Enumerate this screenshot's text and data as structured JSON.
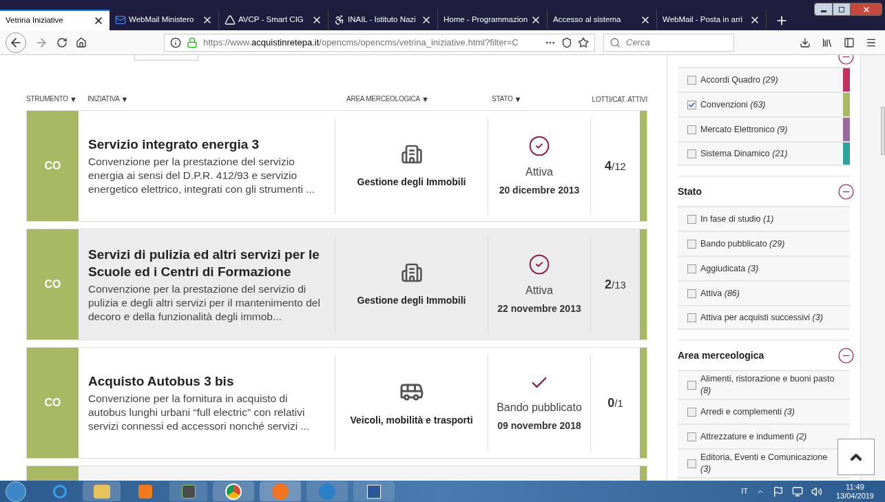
{
  "browser": {
    "tabs": [
      {
        "title": "Vetrina Iniziative",
        "selected": true
      },
      {
        "title": "WebMail Ministero",
        "selected": false
      },
      {
        "title": "AVCP - Smart CIG",
        "selected": false
      },
      {
        "title": "INAIL - Istituto Nazi",
        "selected": false
      },
      {
        "title": "Home - Programmazion",
        "selected": false
      },
      {
        "title": "Accesso al sistema",
        "selected": false
      },
      {
        "title": "WebMail - Posta in arri",
        "selected": false
      }
    ],
    "url_prefix": "https://www.",
    "url_domain": "acquistinretepa.it",
    "url_path": "/opencms/opencms/vetrina_iniziative.html?filter=C",
    "search_placeholder": "Cerca"
  },
  "table": {
    "columns": [
      {
        "label": "STRUMENTO",
        "sort_arrow": "▼"
      },
      {
        "label": "INIZIATIVA",
        "sort_arrow": "▼"
      },
      {
        "label": "AREA MERCEOLOGICA",
        "sort_arrow": "▼"
      },
      {
        "label": "STATO",
        "sort_arrow": "▼"
      },
      {
        "label": "LOTTI/CAT. ATTIVI"
      }
    ],
    "rows": [
      {
        "tool": "CO",
        "title": "Servizio integrato energia 3",
        "description": "Convenzione per la prestazione del servizio energia ai sensi del D.P.R. 412/93 e servizio energetico elettrico, integrati con gli strumenti ...",
        "area": {
          "kind": "building",
          "label": "Gestione degli Immobili"
        },
        "status": {
          "kind": "active",
          "label": "Attiva",
          "date": "20 dicembre 2013"
        },
        "lots_active": "4",
        "lots_total": "/12",
        "shaded": false
      },
      {
        "tool": "CO",
        "title": "Servizi di pulizia ed altri servizi per le Scuole ed i Centri di Formazione",
        "description": "Convenzione per la prestazione del servizio di pulizia e degli altri servizi per il mantenimento del decoro e della funzionalità degli immob...",
        "area": {
          "kind": "building",
          "label": "Gestione degli Immobili"
        },
        "status": {
          "kind": "active",
          "label": "Attiva",
          "date": "22 novembre 2013"
        },
        "lots_active": "2",
        "lots_total": "/13",
        "shaded": true
      },
      {
        "tool": "CO",
        "title": "Acquisto Autobus 3 bis",
        "description": "Convenzione per la fornitura in acquisto di autobus lunghi urbani “full electric” con relativi servizi connessi ed accessori nonché servizi ...",
        "area": {
          "kind": "bus",
          "label": "Veicoli, mobilità e trasporti"
        },
        "status": {
          "kind": "published",
          "label": "Bando pubblicato",
          "date": "09 novembre 2018"
        },
        "lots_active": "0",
        "lots_total": "/1",
        "shaded": false
      }
    ]
  },
  "sidebar": {
    "sections": [
      {
        "expanded": true,
        "items": [
          {
            "label": "Accordi Quadro",
            "count": "(29)",
            "checked": false,
            "color": "#c2325f"
          },
          {
            "label": "Convenzioni",
            "count": "(63)",
            "checked": true,
            "color": "#a9b862"
          },
          {
            "label": "Mercato Elettronico",
            "count": "(9)",
            "checked": false,
            "color": "#9b6a9b"
          },
          {
            "label": "Sistema Dinamico",
            "count": "(21)",
            "checked": false,
            "color": "#2aa39a"
          }
        ]
      },
      {
        "title": "Stato",
        "expanded": true,
        "items": [
          {
            "label": "In fase di studio",
            "count": "(1)",
            "checked": false
          },
          {
            "label": "Bando pubblicato",
            "count": "(29)",
            "checked": false
          },
          {
            "label": "Aggiudicata",
            "count": "(3)",
            "checked": false
          },
          {
            "label": "Attiva",
            "count": "(86)",
            "checked": false
          },
          {
            "label": "Attiva per acquisti successivi",
            "count": "(3)",
            "checked": false
          }
        ]
      },
      {
        "title": "Area merceologica",
        "expanded": true,
        "items": [
          {
            "label": "Alimenti, ristorazione e buoni pasto",
            "count": "(8)",
            "checked": false
          },
          {
            "label": "Arredi e complementi",
            "count": "(3)",
            "checked": false
          },
          {
            "label": "Attrezzature e indumenti",
            "count": "(2)",
            "checked": false
          },
          {
            "label": "Editoria, Eventi e Comunicazione",
            "count": "(3)",
            "checked": false
          }
        ]
      }
    ]
  },
  "taskbar": {
    "language": "IT",
    "time": "11:49",
    "date": "13/04/2019"
  }
}
